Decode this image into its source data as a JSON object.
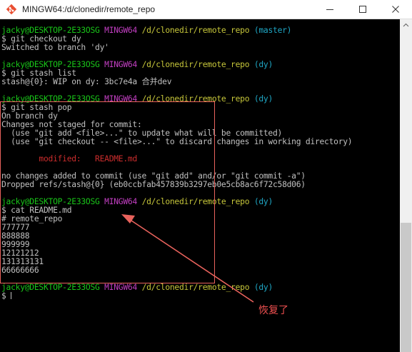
{
  "window": {
    "title": "MINGW64:/d/clonedir/remote_repo",
    "app_icon": "git-bash-icon",
    "controls": {
      "minimize": "minimize-icon",
      "maximize": "maximize-icon",
      "close": "close-icon"
    }
  },
  "colors": {
    "user_host": "#19c719",
    "mingw": "#c33fc3",
    "path": "#c6c63a",
    "branch": "#1fa8c6",
    "text": "#c0c0c0",
    "modified": "#cc2d2d",
    "annotation": "#e8625c"
  },
  "terminal": {
    "lines": [
      {
        "segments": [
          {
            "text": "jacky@DESKTOP-2E33OSG",
            "color": "user_host"
          },
          {
            "text": " "
          },
          {
            "text": "MINGW64",
            "color": "mingw"
          },
          {
            "text": " "
          },
          {
            "text": "/d/clonedir/remote_repo",
            "color": "path"
          },
          {
            "text": " "
          },
          {
            "text": "(master)",
            "color": "branch"
          }
        ]
      },
      {
        "segments": [
          {
            "text": "$ git checkout dy"
          }
        ]
      },
      {
        "segments": [
          {
            "text": "Switched to branch 'dy'"
          }
        ]
      },
      {
        "segments": [
          {
            "text": ""
          }
        ]
      },
      {
        "segments": [
          {
            "text": "jacky@DESKTOP-2E33OSG",
            "color": "user_host"
          },
          {
            "text": " "
          },
          {
            "text": "MINGW64",
            "color": "mingw"
          },
          {
            "text": " "
          },
          {
            "text": "/d/clonedir/remote_repo",
            "color": "path"
          },
          {
            "text": " "
          },
          {
            "text": "(dy)",
            "color": "branch"
          }
        ]
      },
      {
        "segments": [
          {
            "text": "$ git stash list"
          }
        ]
      },
      {
        "segments": [
          {
            "text": "stash@{0}: WIP on dy: 3bc7e4a 合并dev"
          }
        ]
      },
      {
        "segments": [
          {
            "text": ""
          }
        ]
      },
      {
        "segments": [
          {
            "text": "jacky@DESKTOP-2E33OSG",
            "color": "user_host"
          },
          {
            "text": " "
          },
          {
            "text": "MINGW64",
            "color": "mingw"
          },
          {
            "text": " "
          },
          {
            "text": "/d/clonedir/remote_repo",
            "color": "path"
          },
          {
            "text": " "
          },
          {
            "text": "(dy)",
            "color": "branch"
          }
        ]
      },
      {
        "segments": [
          {
            "text": "$ git stash pop"
          }
        ]
      },
      {
        "segments": [
          {
            "text": "On branch dy"
          }
        ]
      },
      {
        "segments": [
          {
            "text": "Changes not staged for commit:"
          }
        ]
      },
      {
        "segments": [
          {
            "text": "  (use \"git add <file>...\" to update what will be committed)"
          }
        ]
      },
      {
        "segments": [
          {
            "text": "  (use \"git checkout -- <file>...\" to discard changes in working directory)"
          }
        ]
      },
      {
        "segments": [
          {
            "text": ""
          }
        ]
      },
      {
        "segments": [
          {
            "text": "        "
          },
          {
            "text": "modified:   README.md",
            "color": "modified"
          }
        ]
      },
      {
        "segments": [
          {
            "text": ""
          }
        ]
      },
      {
        "segments": [
          {
            "text": "no changes added to commit (use \"git add\" and/or \"git commit -a\")"
          }
        ]
      },
      {
        "segments": [
          {
            "text": "Dropped refs/stash@{0} (eb0ccbfab457839b3297eb0e5cb8ac6f72c58d06)"
          }
        ]
      },
      {
        "segments": [
          {
            "text": ""
          }
        ]
      },
      {
        "segments": [
          {
            "text": "jacky@DESKTOP-2E33OSG",
            "color": "user_host"
          },
          {
            "text": " "
          },
          {
            "text": "MINGW64",
            "color": "mingw"
          },
          {
            "text": " "
          },
          {
            "text": "/d/clonedir/remote_repo",
            "color": "path"
          },
          {
            "text": " "
          },
          {
            "text": "(dy)",
            "color": "branch"
          }
        ]
      },
      {
        "segments": [
          {
            "text": "$ cat README.md"
          }
        ]
      },
      {
        "segments": [
          {
            "text": "# remote_repo"
          }
        ]
      },
      {
        "segments": [
          {
            "text": "777777"
          }
        ]
      },
      {
        "segments": [
          {
            "text": "888888"
          }
        ]
      },
      {
        "segments": [
          {
            "text": "999999"
          }
        ]
      },
      {
        "segments": [
          {
            "text": "12121212"
          }
        ]
      },
      {
        "segments": [
          {
            "text": "131313131"
          }
        ]
      },
      {
        "segments": [
          {
            "text": "66666666"
          }
        ]
      },
      {
        "segments": [
          {
            "text": ""
          }
        ]
      },
      {
        "segments": [
          {
            "text": "jacky@DESKTOP-2E33OSG",
            "color": "user_host"
          },
          {
            "text": " "
          },
          {
            "text": "MINGW64",
            "color": "mingw"
          },
          {
            "text": " "
          },
          {
            "text": "/d/clonedir/remote_repo",
            "color": "path"
          },
          {
            "text": " "
          },
          {
            "text": "(dy)",
            "color": "branch"
          }
        ]
      },
      {
        "segments": [
          {
            "text": "$ "
          }
        ]
      }
    ]
  },
  "annotation": {
    "label": "恢复了"
  }
}
